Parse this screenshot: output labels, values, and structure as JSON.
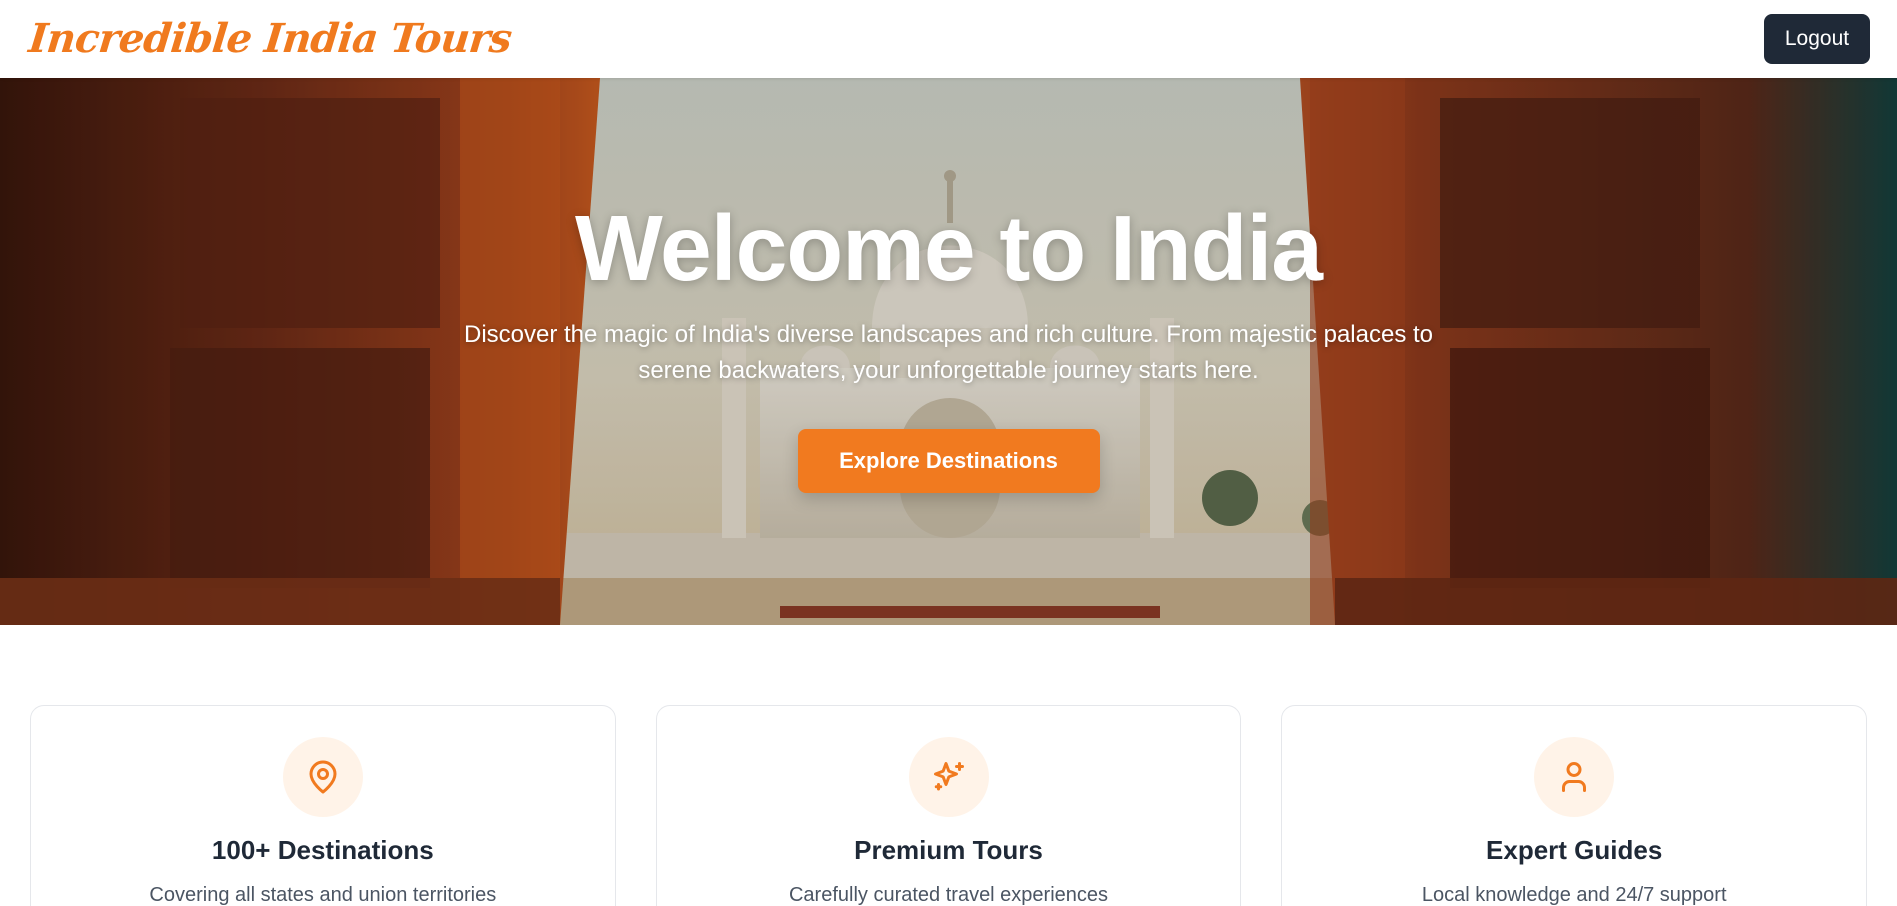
{
  "header": {
    "brand": "Incredible India Tours",
    "logout_label": "Logout"
  },
  "hero": {
    "title": "Welcome to India",
    "subtitle": "Discover the magic of India's diverse landscapes and rich culture. From majestic palaces to serene backwaters, your unforgettable journey starts here.",
    "cta_label": "Explore Destinations"
  },
  "features": [
    {
      "icon": "map-pin-icon",
      "title": "100+ Destinations",
      "description": "Covering all states and union territories"
    },
    {
      "icon": "sparkles-icon",
      "title": "Premium Tours",
      "description": "Carefully curated travel experiences"
    },
    {
      "icon": "user-icon",
      "title": "Expert Guides",
      "description": "Local knowledge and 24/7 support"
    }
  ],
  "colors": {
    "accent": "#f17a1f",
    "dark_button": "#1f2937",
    "icon_bg": "#fff3e8"
  }
}
